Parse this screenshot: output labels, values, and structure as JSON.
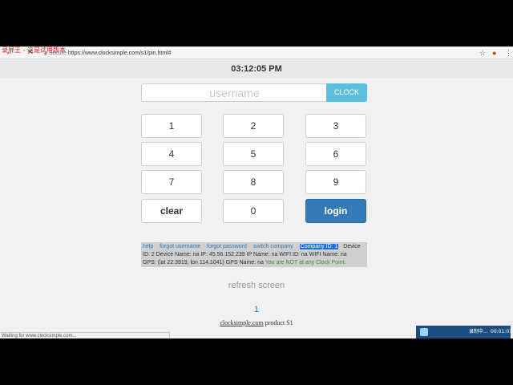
{
  "browser": {
    "watermark": "录屏王 - 这是试用版本",
    "secure_label": "Secure",
    "url": "https://www.clocksimple.com/s1/pin.html#",
    "back_icon": "back-arrow-icon",
    "close_icon": "close-icon"
  },
  "time": "03:12:05 PM",
  "login": {
    "username_placeholder": "username",
    "clock_button": "CLOCK"
  },
  "keypad": {
    "k1": "1",
    "k2": "2",
    "k3": "3",
    "k4": "4",
    "k5": "5",
    "k6": "6",
    "k7": "7",
    "k8": "8",
    "k9": "9",
    "clear": "clear",
    "k0": "0",
    "login": "login"
  },
  "info": {
    "help": "help",
    "forgot_username": "forgot username",
    "forgot_password": "forgot password",
    "switch_company": "switch company",
    "company_id": "Company ID: 1",
    "device_label": "Device",
    "line2": "ID: 2    Device Name: na    IP: 45.56.152.239    IP Name: na    WIFI ID: na    WIFI Name: na",
    "gps": "GPS: (lat 22.3919, lon 114.1041)    GPS Name: na",
    "warning": "You are NOT at any Clock Point."
  },
  "refresh": "refresh screen",
  "page_number": "1",
  "product": {
    "site": "clocksimple.com",
    "suffix": " product S1"
  },
  "status_bar": "Waiting for www.clocksimple.com...",
  "recorder": {
    "label": "录制中...",
    "time": "00:01:01"
  }
}
